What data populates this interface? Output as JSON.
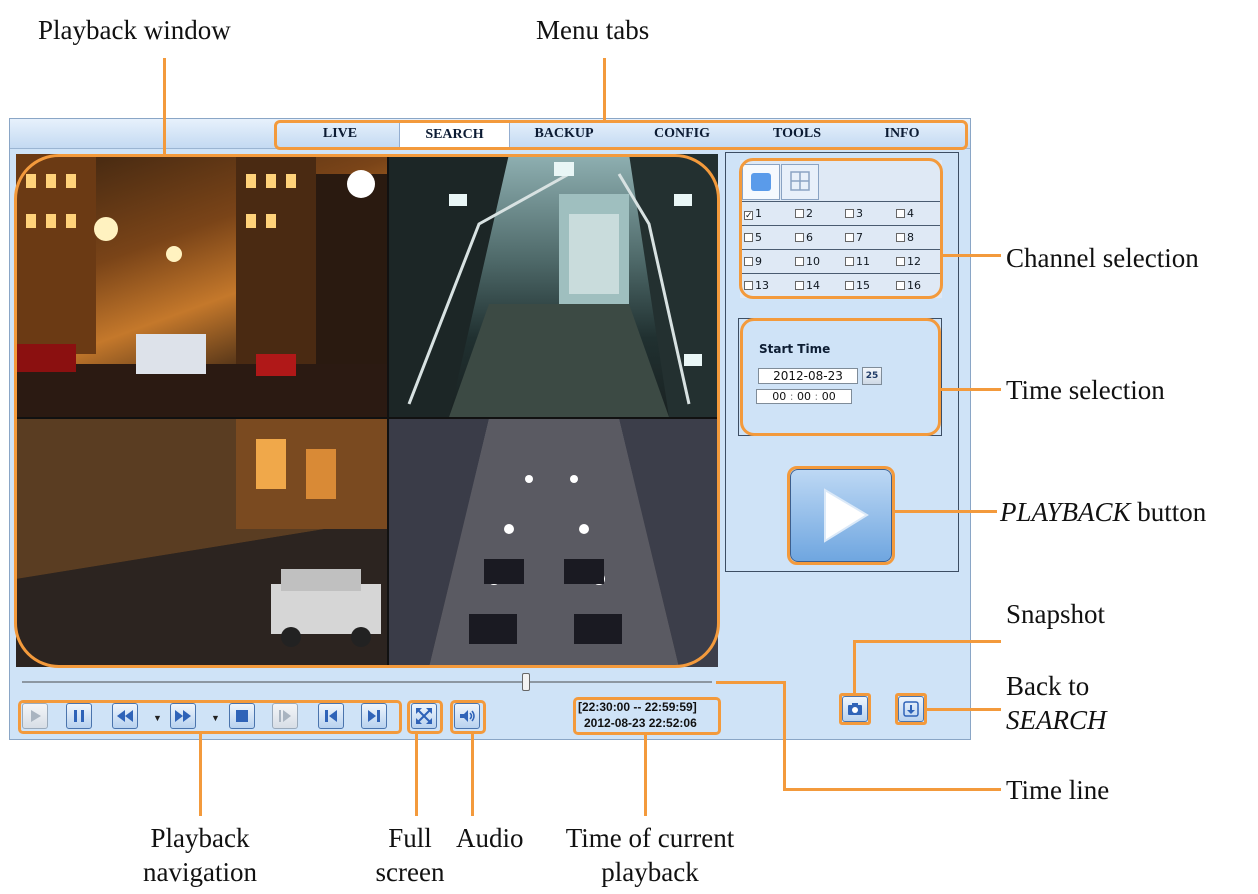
{
  "callouts": {
    "playback_window": "Playback window",
    "menu_tabs": "Menu tabs",
    "channel_selection": "Channel selection",
    "time_selection": "Time selection",
    "playback_button_italic": "PLAYBACK",
    "playback_button_rest": " button",
    "snapshot": "Snapshot",
    "back_to_line1": "Back to",
    "back_to_line2": "SEARCH",
    "time_line": "Time line",
    "playback_navigation_line1": "Playback",
    "playback_navigation_line2": "navigation",
    "full_screen_line1": "Full",
    "full_screen_line2": "screen",
    "audio": "Audio",
    "time_current_line1": "Time of current",
    "time_current_line2": "playback"
  },
  "menu": {
    "tabs": [
      "LIVE",
      "SEARCH",
      "BACKUP",
      "CONFIG",
      "TOOLS",
      "INFO"
    ],
    "active": "SEARCH"
  },
  "channels": {
    "labels": [
      "1",
      "2",
      "3",
      "4",
      "5",
      "6",
      "7",
      "8",
      "9",
      "10",
      "11",
      "12",
      "13",
      "14",
      "15",
      "16"
    ],
    "checked": [
      "1"
    ]
  },
  "start_time": {
    "title": "Start Time",
    "date": "2012-08-23",
    "calendar_label": "25",
    "hour": "00",
    "minute": "00",
    "second": "00",
    "separator": ":"
  },
  "playback": {
    "range": "[22:30:00 -- 22:59:59]",
    "current": "2012-08-23 22:52:06",
    "timeline_position": 0.73
  },
  "colors": {
    "callout_orange": "#f39a3c",
    "panel_bg": "#cfe3f7",
    "button_blue": "#2f63b8"
  },
  "icons": {
    "play": "play-icon",
    "pause": "pause-icon",
    "rewind": "rewind-icon",
    "fast_forward": "fast-forward-icon",
    "stop": "stop-icon",
    "step": "step-frame-icon",
    "prev": "skip-previous-icon",
    "next": "skip-next-icon",
    "fullscreen": "fullscreen-icon",
    "audio": "audio-icon",
    "snapshot": "camera-icon",
    "back": "back-to-search-icon"
  }
}
